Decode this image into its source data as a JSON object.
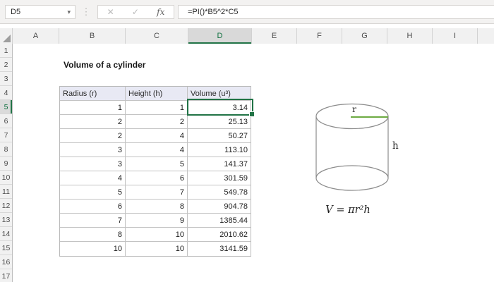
{
  "colors": {
    "selection_green": "#217346",
    "header_link_green": "#0E703E",
    "diagram_green": "#70AD47",
    "table_header_fill": "#E8E9F4"
  },
  "formula_bar": {
    "name_box_value": "D5",
    "formula": "=PI()*B5^2*C5"
  },
  "icons": {
    "dropdown": "▾",
    "more_dots": "⋮",
    "cancel": "✕",
    "enter": "✓",
    "function": "fx"
  },
  "grid": {
    "column_labels": [
      "A",
      "B",
      "C",
      "D",
      "E",
      "F",
      "G",
      "H",
      "I"
    ],
    "row_labels": [
      "1",
      "2",
      "3",
      "4",
      "5",
      "6",
      "7",
      "8",
      "9",
      "10",
      "11",
      "12",
      "13",
      "14",
      "15",
      "16",
      "17"
    ],
    "selected_cell": "D5",
    "selected_column": "D",
    "selected_row": "5"
  },
  "sheet": {
    "title": "Volume of a cylinder",
    "table": {
      "headers": [
        "Radius (r)",
        "Height (h)",
        "Volume (u³)"
      ],
      "rows": [
        [
          "1",
          "1",
          "3.14"
        ],
        [
          "2",
          "2",
          "25.13"
        ],
        [
          "2",
          "4",
          "50.27"
        ],
        [
          "3",
          "4",
          "113.10"
        ],
        [
          "3",
          "5",
          "141.37"
        ],
        [
          "4",
          "6",
          "301.59"
        ],
        [
          "5",
          "7",
          "549.78"
        ],
        [
          "6",
          "8",
          "904.78"
        ],
        [
          "7",
          "9",
          "1385.44"
        ],
        [
          "8",
          "10",
          "2010.62"
        ],
        [
          "10",
          "10",
          "3141.59"
        ]
      ]
    },
    "diagram": {
      "radius_label": "r",
      "height_label": "h",
      "formula": "V = πr²h"
    }
  }
}
